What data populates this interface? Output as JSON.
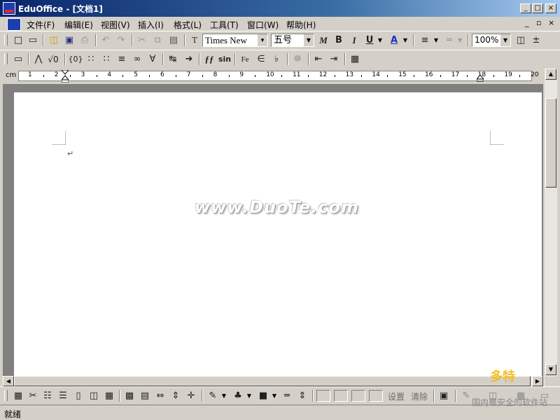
{
  "window": {
    "title": "EduOffice - [文档1]",
    "controls": [
      "_",
      "□",
      "×"
    ]
  },
  "menu": {
    "items": [
      "文件(F)",
      "编辑(E)",
      "视图(V)",
      "插入(I)",
      "格式(L)",
      "工具(T)",
      "窗口(W)",
      "帮助(H)"
    ],
    "mdi_controls": [
      "_",
      "▫",
      "×"
    ]
  },
  "toolbar1": {
    "font_name": "Times New",
    "font_size": "五号",
    "zoom": "100%",
    "bold": "B",
    "italic": "I",
    "underline": "U",
    "font_color": "A",
    "plus_minus": "±",
    "math_italic": "M"
  },
  "toolbar2": {
    "sqrt": "√0",
    "braces": "{0}",
    "fancy_f": "ƒƒ",
    "sin": "sin",
    "fe": "Fe"
  },
  "ruler": {
    "unit": "cm",
    "ticks": [
      "1",
      "2",
      "3",
      "4",
      "5",
      "6",
      "7",
      "8",
      "9",
      "10",
      "11",
      "12",
      "13",
      "14",
      "15",
      "16",
      "17",
      "18",
      "19",
      "20"
    ]
  },
  "document": {
    "paragraph_mark": "↵"
  },
  "bottom_toolbar": {
    "settings_label": "设置",
    "clear_label": "清除"
  },
  "status": {
    "text": "就绪"
  },
  "watermark": {
    "text": "www.DuoTe.com",
    "logo_cn": "多特",
    "logo_sub": "国内最安全的软件站"
  },
  "colors": {
    "title_start": "#0a246a",
    "title_end": "#a6caf0",
    "chrome": "#d4d0c8",
    "workspace": "#808080",
    "font_color_accent": "#1a2ec8"
  }
}
